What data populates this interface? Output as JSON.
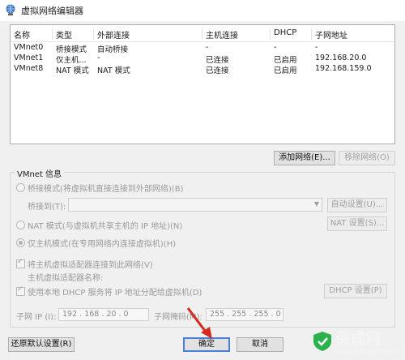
{
  "window": {
    "title": "虚拟网络编辑器"
  },
  "table": {
    "headers": [
      "名称",
      "类型",
      "外部连接",
      "主机连接",
      "DHCP",
      "子网地址"
    ],
    "rows": [
      [
        "VMnet0",
        "桥接模式",
        "自动桥接",
        "-",
        "-",
        "-"
      ],
      [
        "VMnet1",
        "仅主机...",
        "-",
        "已连接",
        "已启用",
        "192.168.20.0"
      ],
      [
        "VMnet8",
        "NAT 模式",
        "NAT 模式",
        "已连接",
        "已启用",
        "192.168.159.0"
      ]
    ]
  },
  "buttons": {
    "add_network": "添加网络(E)...",
    "remove_network": "移除网络(O)",
    "auto_settings": "自动设置(U)...",
    "nat_settings": "NAT 设置(S)...",
    "dhcp_settings": "DHCP 设置(P)",
    "restore_defaults": "还原默认设置(R)",
    "ok": "确定",
    "cancel": "取消"
  },
  "vmnet_info": {
    "title": "VMnet 信息",
    "bridged_label": "桥接模式(将虚拟机直接连接到外部网络)(B)",
    "bridge_to_label": "桥接到(T):",
    "nat_label": "NAT 模式(与虚拟机共享主机的 IP 地址)(N)",
    "hostonly_label": "仅主机模式(在专用网络内连接虚拟机)(H)",
    "connect_adapter_label": "将主机虚拟适配器连接到此网络(V)",
    "adapter_name_label": "主机虚拟适配器名称:",
    "dhcp_label": "使用本地 DHCP 服务将 IP 地址分配给虚拟机(D)",
    "subnet_ip_label": "子网 IP (I):",
    "subnet_ip_value": "192 . 168 . 20 . 0",
    "subnet_mask_label": "子网掩码(M):",
    "subnet_mask_value": "255 . 255 . 255 . 0"
  },
  "watermark": {
    "text": "保成网",
    "url": "www.zsbaochen.com"
  },
  "colors": {
    "arrow": "#d42a20",
    "watermark_green": "#2bb24c"
  }
}
